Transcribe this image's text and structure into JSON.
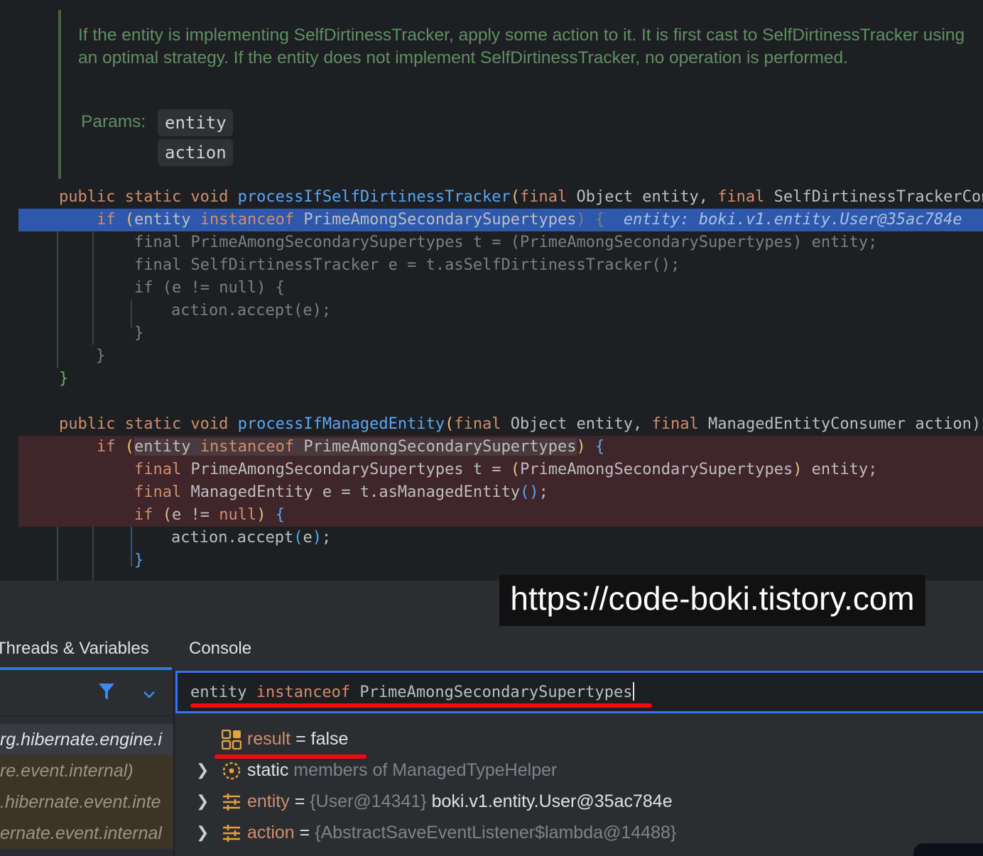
{
  "editor": {
    "doc_comment": "If the entity is implementing SelfDirtinessTracker, apply some action to it. It is first cast to SelfDirtinessTracker using an optimal strategy. If the entity does not implement SelfDirtinessTracker, no operation is performed.",
    "params_label": "Params:",
    "params": [
      "entity",
      "action"
    ],
    "code": {
      "l1_kw": "public static void ",
      "l1_fn": "processIfSelfDirtinessTracker",
      "l1_p1": "(",
      "l1_rest_kw1": "final",
      "l1_rest1": " Object entity, ",
      "l1_rest_kw2": "final",
      "l1_rest2": " SelfDirtinessTrackerCon",
      "l2_if": "if ",
      "l2_paren": "(",
      "l2_a": "entity ",
      "l2_kw": "instanceof",
      "l2_b": " PrimeAmongSecondarySupertypes",
      "l2_close": ") {",
      "l2_inlay": "entity: boki.v1.entity.User@35ac784e",
      "l3": "final PrimeAmongSecondarySupertypes t = (PrimeAmongSecondarySupertypes) entity;",
      "l4": "final SelfDirtinessTracker e = t.asSelfDirtinessTracker();",
      "l5": "if (e != null) {",
      "l6": "action.accept(e);",
      "l7": "}",
      "l8": "}",
      "l9": "}",
      "m1_kw": "public static void ",
      "m1_fn": "processIfManagedEntity",
      "m1_p": "(",
      "m1_kw2": "final",
      "m1_a": " Object entity, ",
      "m1_kw3": "final",
      "m1_b": " ManagedEntityConsumer action) ",
      "m2_if": "if ",
      "m2_paren": "(",
      "m2_a": "entity ",
      "m2_kw": "instanceof",
      "m2_b": " PrimeAmongSecondarySupertypes",
      "m2_close": ")",
      "m2_brace": " {",
      "m3_kw": "final",
      "m3_a": " PrimeAmongSecondarySupertypes t = ",
      "m3_p": "(",
      "m3_b": "PrimeAmongSecondarySupertypes",
      "m3_p2": ")",
      "m3_c": " entity;",
      "m4_kw": "final",
      "m4_a": " ManagedEntity e = t.asManagedEntity",
      "m4_p": "()",
      "m4_c": ";",
      "m5_kw": "if",
      "m5_p": " (",
      "m5_a": "e != ",
      "m5_kw2": "null",
      "m5_p2": ")",
      "m5_brace": " {",
      "m6_a": "action.accept",
      "m6_p": "(",
      "m6_b": "e",
      "m6_p2": ")",
      "m6_c": ";",
      "m7": "}"
    }
  },
  "watermark": "https://code-boki.tistory.com",
  "debugger": {
    "tabs": [
      "Threads & Variables",
      "Console"
    ],
    "frames": [
      "rg.hibernate.engine.i",
      "re.event.internal)",
      ".hibernate.event.inte",
      "ernate.event.internal"
    ],
    "expression": {
      "a": "entity ",
      "kw": "instanceof",
      "b": " PrimeAmongSecondarySupertypes"
    },
    "variables": [
      {
        "name": "result",
        "eq": " = ",
        "value": "false",
        "icon": "result-icon"
      },
      {
        "name": "static",
        "rest": " members of ManagedTypeHelper",
        "icon": "static-members-icon"
      },
      {
        "name": "entity",
        "eq": " = ",
        "ref": "{User@14341}",
        "value": " boki.v1.entity.User@35ac784e",
        "icon": "field-icon"
      },
      {
        "name": "action",
        "eq": " = ",
        "ref": "{AbstractSaveEventListener$lambda@14488}",
        "icon": "field-icon"
      }
    ]
  },
  "colors": {
    "accent": "#3574f0",
    "highlight_red": "#f00c0c",
    "breakpoint_line": "#40252a",
    "exec_line": "#2d58ac"
  }
}
